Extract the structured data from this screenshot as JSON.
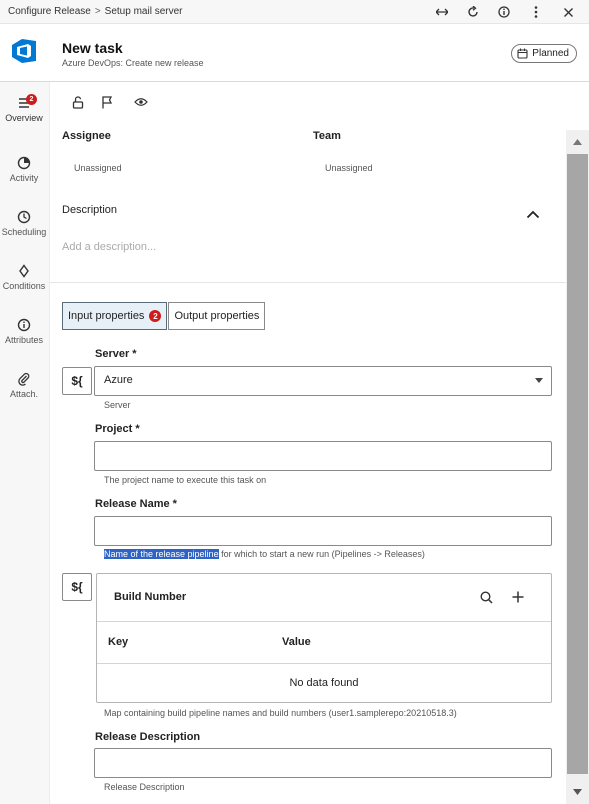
{
  "breadcrumb": {
    "parent": "Configure Release",
    "separator": ">",
    "current": "Setup mail server"
  },
  "window_controls": [
    "expand-horizontal-icon",
    "refresh-icon",
    "info-icon",
    "more-vertical-icon",
    "close-icon"
  ],
  "header": {
    "title": "New task",
    "subtitle": "Azure DevOps: Create new release",
    "status": "Planned",
    "status_icon": "calendar-icon",
    "logo_color": "#0078d4"
  },
  "nav": [
    {
      "label": "Overview",
      "icon": "list-icon",
      "badge": "2",
      "active": true
    },
    {
      "label": "Activity",
      "icon": "activity-icon"
    },
    {
      "label": "Scheduling",
      "icon": "clock-icon"
    },
    {
      "label": "Conditions",
      "icon": "diamond-icon"
    },
    {
      "label": "Attributes",
      "icon": "info-circle-icon"
    },
    {
      "label": "Attach.",
      "icon": "paperclip-icon"
    }
  ],
  "toolbar": [
    "unlock-icon",
    "flag-icon",
    "eye-icon"
  ],
  "assignee": {
    "label": "Assignee",
    "value": "Unassigned"
  },
  "team": {
    "label": "Team",
    "value": "Unassigned"
  },
  "description": {
    "label": "Description",
    "placeholder": "Add a description..."
  },
  "tabs": [
    {
      "label": "Input properties",
      "badge": "2",
      "active": true
    },
    {
      "label": "Output properties",
      "active": false
    }
  ],
  "variable_button_label": "${",
  "fields": {
    "server": {
      "label": "Server *",
      "value": "Azure",
      "hint": "Server"
    },
    "project": {
      "label": "Project *",
      "value": "",
      "hint": "The project name to execute this task on"
    },
    "release_name": {
      "label": "Release Name *",
      "value": "",
      "hint_selected": "Name of the release pipeline",
      "hint_rest": " for which to start a new run (Pipelines -> Releases)"
    },
    "build_number": {
      "title": "Build Number",
      "columns": [
        "Key",
        "Value"
      ],
      "empty_text": "No data found",
      "hint": "Map containing build pipeline names and build numbers (user1.samplerepo:20210518.3)"
    },
    "release_description": {
      "label": "Release Description",
      "value": "",
      "hint": "Release Description"
    }
  },
  "colors": {
    "accent": "#0078d4",
    "badge": "#d01b1b",
    "selection": "#2e63c5",
    "active_tab": "#e8f0f7"
  }
}
